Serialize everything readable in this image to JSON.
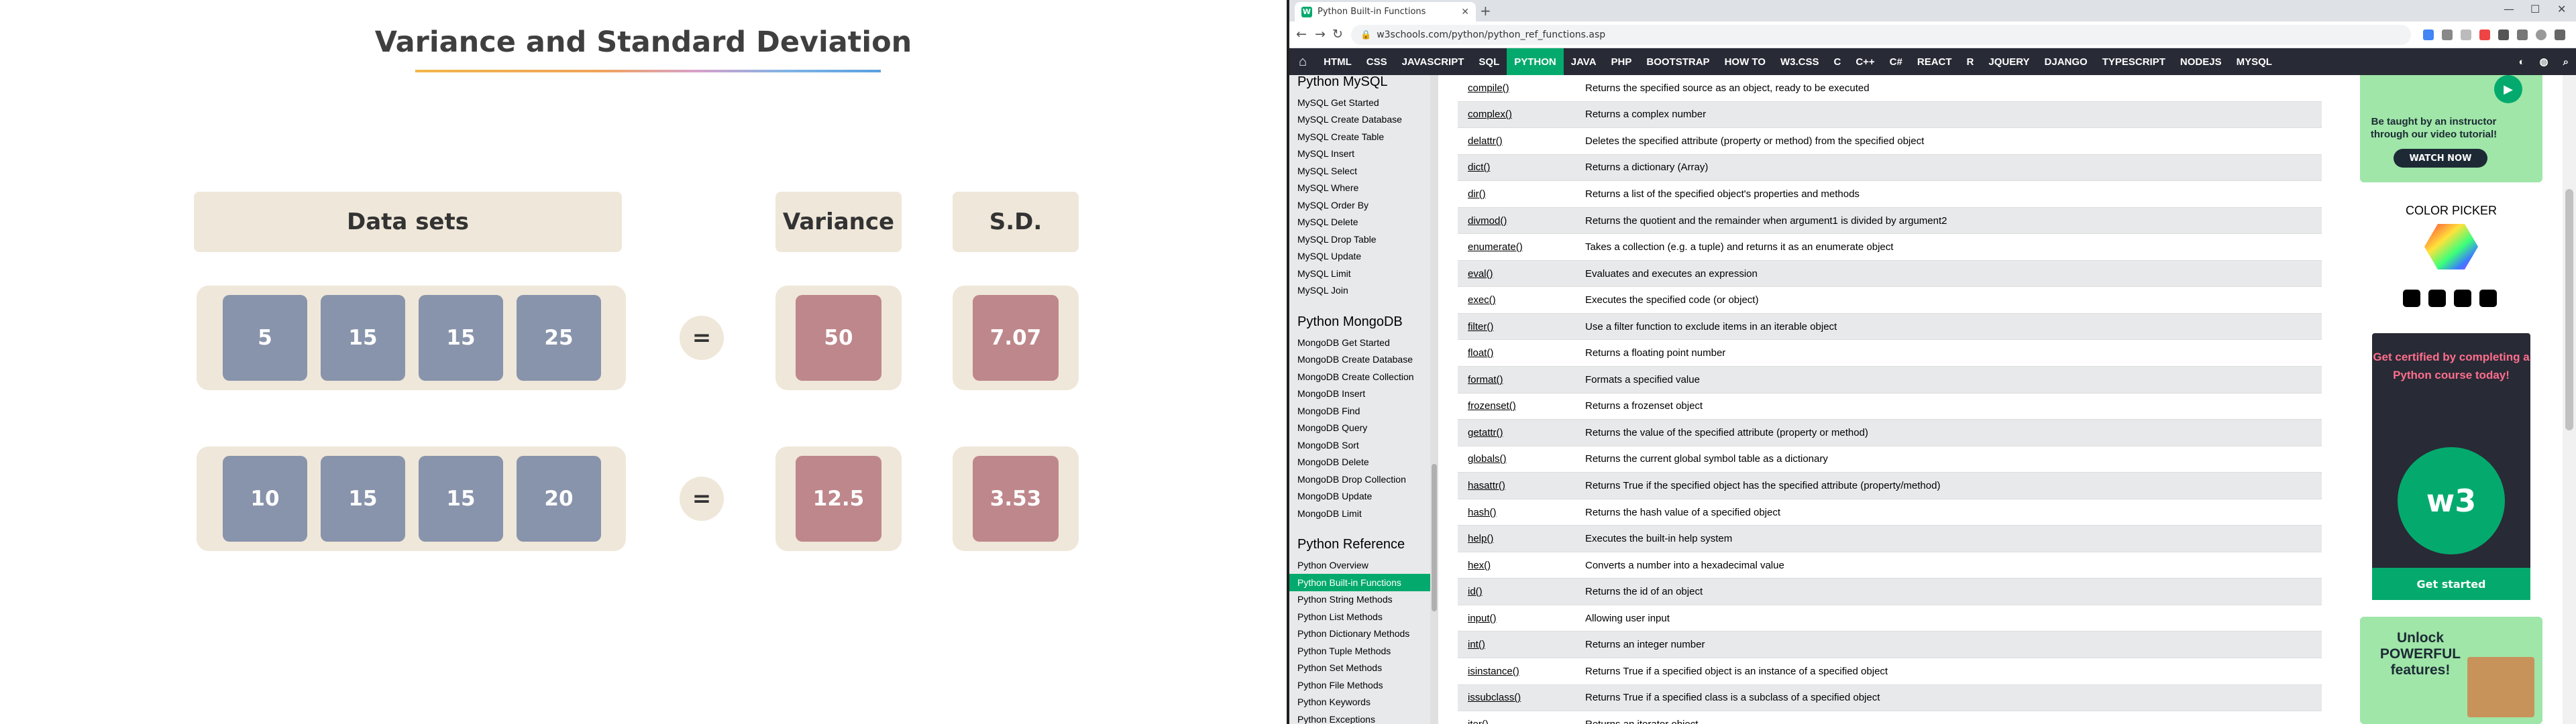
{
  "slide": {
    "title": "Variance and Standard Deviation",
    "headers": {
      "datasets": "Data sets",
      "variance": "Variance",
      "sd": "S.D."
    },
    "equals": "=",
    "rows": [
      {
        "values": [
          "5",
          "15",
          "15",
          "25"
        ],
        "variance": "50",
        "sd": "7.07"
      },
      {
        "values": [
          "10",
          "15",
          "15",
          "20"
        ],
        "variance": "12.5",
        "sd": "3.53"
      }
    ],
    "colors": {
      "tile_blue": "#8894ab",
      "tile_red": "#be878b",
      "panel": "#efe7d9"
    }
  },
  "browser": {
    "tab_title": "Python Built-in Functions",
    "url": "w3schools.com/python/python_ref_functions.asp",
    "nav": {
      "items": [
        "HTML",
        "CSS",
        "JAVASCRIPT",
        "SQL",
        "PYTHON",
        "JAVA",
        "PHP",
        "BOOTSTRAP",
        "HOW TO",
        "W3.CSS",
        "C",
        "C++",
        "C#",
        "REACT",
        "R",
        "JQUERY",
        "DJANGO",
        "TYPESCRIPT",
        "NODEJS",
        "MYSQL"
      ],
      "active": "PYTHON"
    },
    "sidebar": {
      "sections": [
        {
          "title": "Python MySQL",
          "items": [
            "MySQL Get Started",
            "MySQL Create Database",
            "MySQL Create Table",
            "MySQL Insert",
            "MySQL Select",
            "MySQL Where",
            "MySQL Order By",
            "MySQL Delete",
            "MySQL Drop Table",
            "MySQL Update",
            "MySQL Limit",
            "MySQL Join"
          ]
        },
        {
          "title": "Python MongoDB",
          "items": [
            "MongoDB Get Started",
            "MongoDB Create Database",
            "MongoDB Create Collection",
            "MongoDB Insert",
            "MongoDB Find",
            "MongoDB Query",
            "MongoDB Sort",
            "MongoDB Delete",
            "MongoDB Drop Collection",
            "MongoDB Update",
            "MongoDB Limit"
          ]
        },
        {
          "title": "Python Reference",
          "items": [
            "Python Overview",
            "Python Built-in Functions",
            "Python String Methods",
            "Python List Methods",
            "Python Dictionary Methods",
            "Python Tuple Methods",
            "Python Set Methods",
            "Python File Methods",
            "Python Keywords",
            "Python Exceptions"
          ]
        }
      ],
      "active": "Python Built-in Functions"
    },
    "functions": [
      {
        "name": "compile()",
        "desc": "Returns the specified source as an object, ready to be executed"
      },
      {
        "name": "complex()",
        "desc": "Returns a complex number"
      },
      {
        "name": "delattr()",
        "desc": "Deletes the specified attribute (property or method) from the specified object"
      },
      {
        "name": "dict()",
        "desc": "Returns a dictionary (Array)"
      },
      {
        "name": "dir()",
        "desc": "Returns a list of the specified object's properties and methods"
      },
      {
        "name": "divmod()",
        "desc": "Returns the quotient and the remainder when argument1 is divided by argument2"
      },
      {
        "name": "enumerate()",
        "desc": "Takes a collection (e.g. a tuple) and returns it as an enumerate object"
      },
      {
        "name": "eval()",
        "desc": "Evaluates and executes an expression"
      },
      {
        "name": "exec()",
        "desc": "Executes the specified code (or object)"
      },
      {
        "name": "filter()",
        "desc": "Use a filter function to exclude items in an iterable object"
      },
      {
        "name": "float()",
        "desc": "Returns a floating point number"
      },
      {
        "name": "format()",
        "desc": "Formats a specified value"
      },
      {
        "name": "frozenset()",
        "desc": "Returns a frozenset object"
      },
      {
        "name": "getattr()",
        "desc": "Returns the value of the specified attribute (property or method)"
      },
      {
        "name": "globals()",
        "desc": "Returns the current global symbol table as a dictionary"
      },
      {
        "name": "hasattr()",
        "desc": "Returns True if the specified object has the specified attribute (property/method)"
      },
      {
        "name": "hash()",
        "desc": "Returns the hash value of a specified object"
      },
      {
        "name": "help()",
        "desc": "Executes the built-in help system"
      },
      {
        "name": "hex()",
        "desc": "Converts a number into a hexadecimal value"
      },
      {
        "name": "id()",
        "desc": "Returns the id of an object"
      },
      {
        "name": "input()",
        "desc": "Allowing user input"
      },
      {
        "name": "int()",
        "desc": "Returns an integer number"
      },
      {
        "name": "isinstance()",
        "desc": "Returns True if a specified object is an instance of a specified object"
      },
      {
        "name": "issubclass()",
        "desc": "Returns True if a specified class is a subclass of a specified object"
      },
      {
        "name": "iter()",
        "desc": "Returns an iterator object"
      }
    ],
    "ads": {
      "video_text": "Be taught by an instructor through our video tutorial!",
      "video_button": "WATCH NOW",
      "color_picker": "COLOR PICKER",
      "cert_text": "Get certified by completing a Python course today!",
      "cert_badge": "w3",
      "cert_button": "Get started",
      "unlock_text": "Unlock POWERFUL features!"
    },
    "colors": {
      "accent": "#04aa6d",
      "nav_bg": "#282a35",
      "sidebar_bg": "#e7e9eb"
    }
  }
}
